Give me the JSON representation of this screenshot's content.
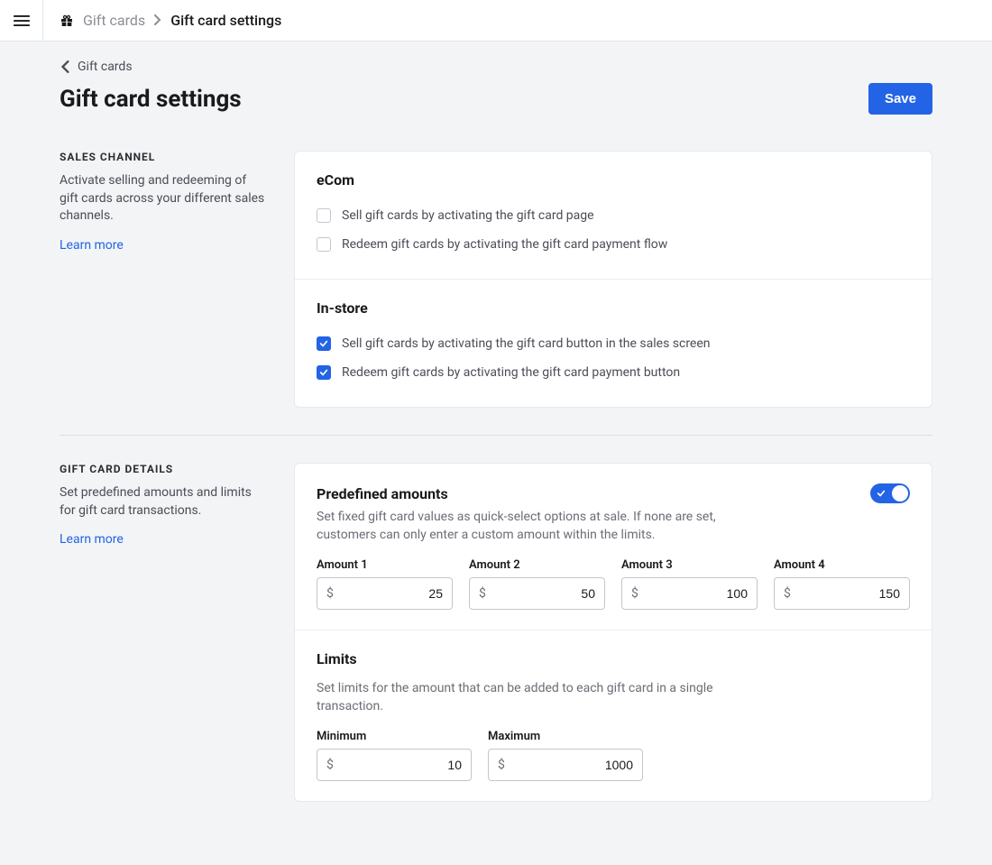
{
  "topbar": {
    "breadcrumb_parent": "Gift cards",
    "breadcrumb_current": "Gift card settings"
  },
  "back": {
    "label": "Gift cards"
  },
  "page_title": "Gift card settings",
  "save_label": "Save",
  "sections": {
    "sales_channel": {
      "heading": "SALES CHANNEL",
      "description": "Activate selling and redeeming of gift cards across your different sales channels.",
      "learn_more": "Learn more",
      "ecom_title": "eCom",
      "ecom_sell": "Sell gift cards by activating the gift card page",
      "ecom_redeem": "Redeem gift cards by activating the gift card payment flow",
      "instore_title": "In-store",
      "instore_sell": "Sell gift cards by activating the gift card button in the sales screen",
      "instore_redeem": "Redeem gift cards by activating the gift card payment button"
    },
    "details": {
      "heading": "GIFT CARD DETAILS",
      "description": "Set predefined amounts and limits for gift card transactions.",
      "learn_more": "Learn more",
      "predef_title": "Predefined amounts",
      "predef_help": "Set fixed gift card values as quick-select options at sale. If none are set, customers can only enter a custom amount within the limits.",
      "amount_labels": [
        "Amount 1",
        "Amount 2",
        "Amount 3",
        "Amount 4"
      ],
      "amount_values": [
        "25",
        "50",
        "100",
        "150"
      ],
      "limits_title": "Limits",
      "limits_help": "Set limits for the amount that can be added to each gift card in a single transaction.",
      "min_label": "Minimum",
      "max_label": "Maximum",
      "min_value": "10",
      "max_value": "1000",
      "currency": "$"
    }
  }
}
